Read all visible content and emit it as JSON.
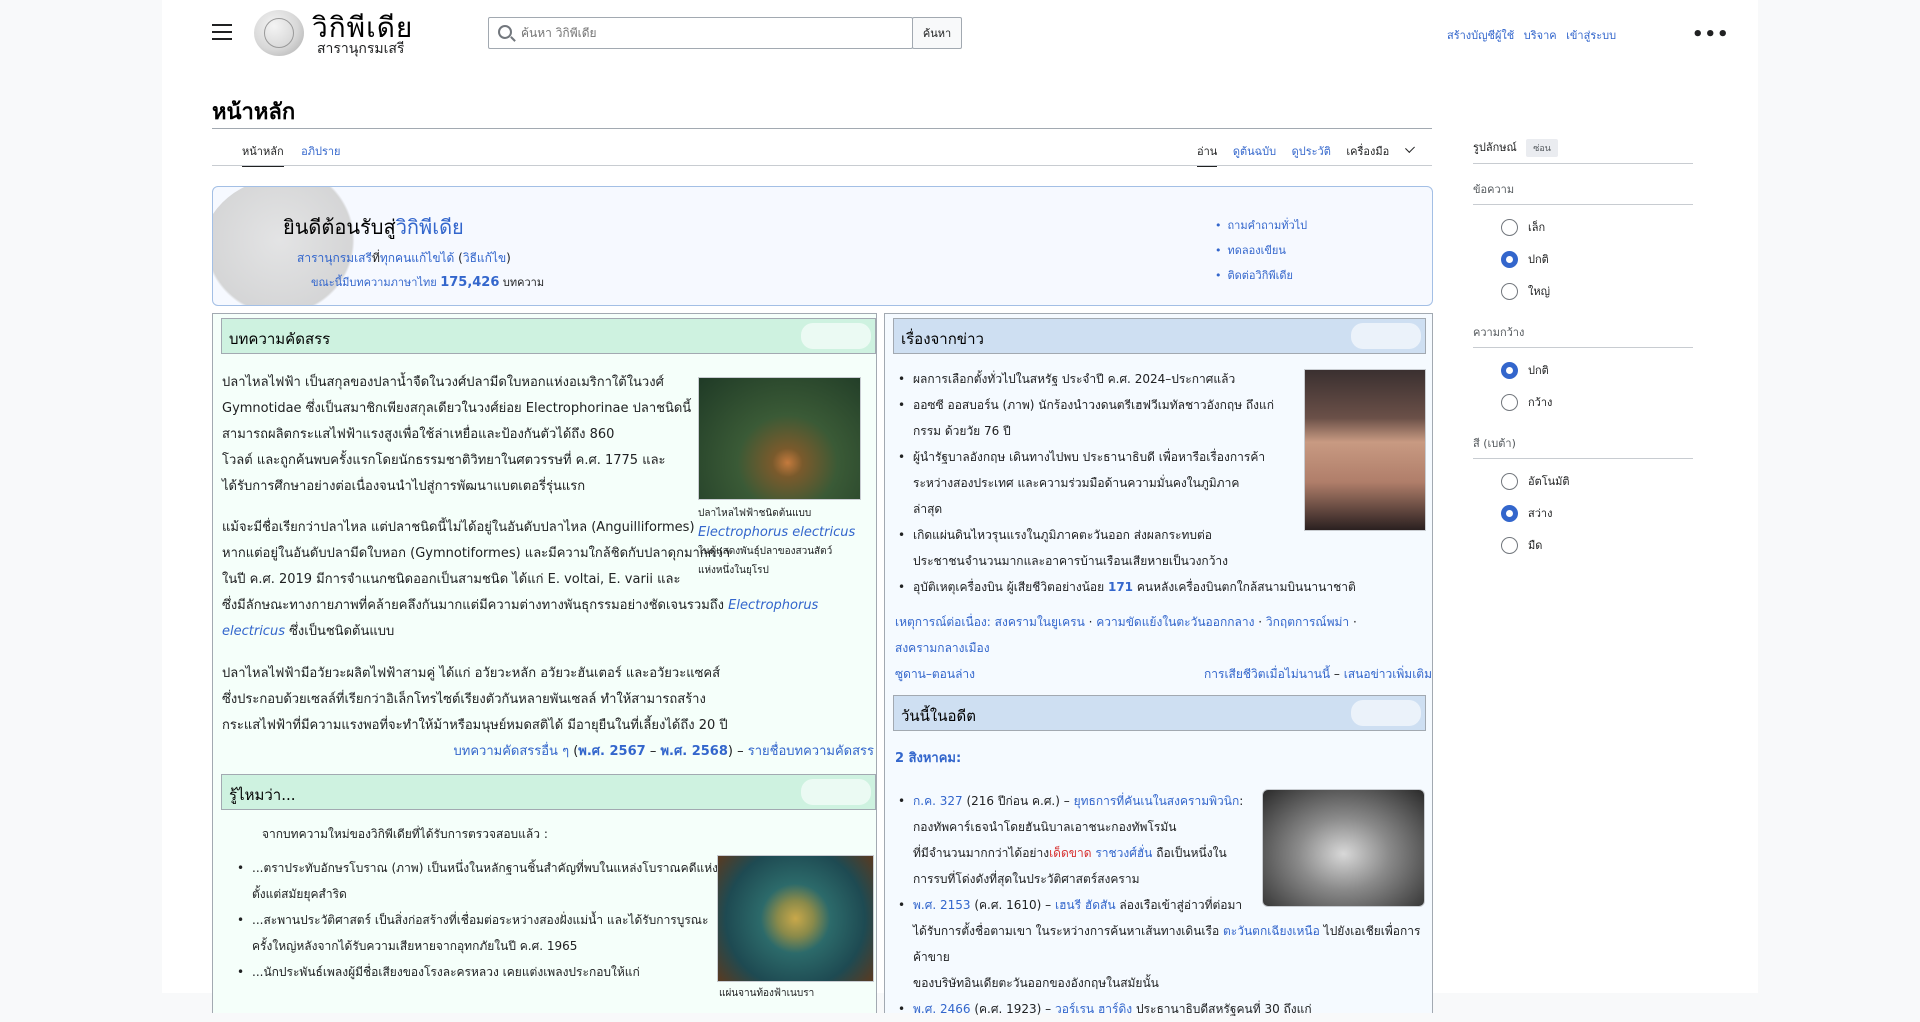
{
  "header": {
    "logo_title": "วิกิพีเดีย",
    "logo_subtitle": "สารานุกรมเสรี",
    "search_placeholder": "ค้นหา วิกิพีเดีย",
    "search_button": "ค้นหา",
    "top_links": [
      "สร้างบัญชีผู้ใช้",
      "บริจาค",
      "เข้าสู่ระบบ"
    ],
    "more": "•••"
  },
  "page": {
    "title": "หน้าหลัก",
    "tabs_left": [
      "หน้าหลัก",
      "อภิปราย"
    ],
    "tabs_right": [
      "อ่าน",
      "ดูต้นฉบับ",
      "ดูประวัติ",
      "เครื่องมือ"
    ]
  },
  "welcome": {
    "heading_plain": "ยินดีต้อนรับสู่",
    "heading_link": "วิกิพีเดีย",
    "sub_link1": "สารานุกรมเสรี",
    "sub_text": "ที่",
    "sub_link2": "ทุกคนแก้ไขได้",
    "sub_paren": "วิธีแก้ไข",
    "count_prefix_link": "ขณะนี้มีบทความภาษาไทย",
    "count_number": "175,426",
    "count_suffix": "บทความ",
    "links": [
      "ถามคำถามทั่วไป",
      "ทดลองเขียน",
      "ติดต่อวิกิพีเดีย"
    ]
  },
  "featured": {
    "heading": "บทความคัดสรร",
    "p1_l1": "ปลาไหลไฟฟ้า เป็นสกุลของปลาน้ำจืดในวงศ์ปลามีดใบหอกแห่งอเมริกาใต้ในวงศ์",
    "p1_l2": "Gymnotidae ซึ่งเป็นสมาชิกเพียงสกุลเดียวในวงศ์ย่อย Electrophorinae ปลาชนิดนี้",
    "p1_l3": "สามารถผลิตกระแสไฟฟ้าแรงสูงเพื่อใช้ล่าเหยื่อและป้องกันตัวได้ถึง 860",
    "p1_l4": "โวลต์ และถูกค้นพบครั้งแรกโดยนักธรรมชาติวิทยาในศตวรรษที่ ค.ศ. 1775 และ",
    "p1_l5": "ได้รับการศึกษาอย่างต่อเนื่องจนนำไปสู่การพัฒนาแบตเตอรี่รุ่นแรก",
    "p2_l1": "แม้จะมีชื่อเรียกว่าปลาไหล แต่ปลาชนิดนี้ไม่ได้อยู่ในอันดับปลาไหล (Anguilliformes)",
    "p2_l2": "หากแต่อยู่ในอันดับปลามีดใบหอก (Gymnotiformes) และมีความใกล้ชิดกับปลาดุกมากกว่า",
    "p2_l3": "ในปี ค.ศ. 2019 มีการจำแนกชนิดออกเป็นสามชนิด ได้แก่ E. voltai, E. varii และ",
    "p2_l4": "ซึ่งมีลักษณะทางกายภาพที่คล้ายคลึงกันมากแต่มีความต่างทางพันธุกรรมอย่างชัดเจนรวมถึง",
    "p2_l5_italic": "Electrophorus",
    "p2_l6_italic": "electricus",
    "p2_l6_rest": "ซึ่งเป็นชนิดต้นแบบ",
    "p3_l1": "ปลาไหลไฟฟ้ามีอวัยวะผลิตไฟฟ้าสามคู่ ได้แก่ อวัยวะหลัก อวัยวะฮันเตอร์ และอวัยวะแซคส์",
    "p3_l2": "ซึ่งประกอบด้วยเซลล์ที่เรียกว่าอิเล็กโทรไซต์เรียงตัวกันหลายพันเซลล์ ทำให้สามารถสร้าง",
    "p3_l3": "กระแสไฟฟ้าที่มีความแรงพอที่จะทำให้ม้าหรือมนุษย์หมดสติได้ มีอายุยืนในที่เลี้ยงได้ถึง 20 ปี",
    "footer_link1": "บทความคัดสรรอื่น ๆ",
    "footer_paren_open": "(",
    "footer_y1": "พ.ศ. 2567",
    "footer_mid": "–",
    "footer_y2": "พ.ศ. 2568",
    "footer_paren_close": ") –",
    "footer_link2": "รายชื่อบทความคัดสรร",
    "caption_l1": "ปลาไหลไฟฟ้าชนิดต้นแบบ",
    "caption_italic": "Electrophorus electricus",
    "caption_l3": "ในตู้แสดงพันธุ์ปลาของสวนสัตว์",
    "caption_l4": "แห่งหนึ่งในยุโรป"
  },
  "dyk": {
    "heading": "รู้ไหมว่า...",
    "intro": "จากบทความใหม่ของวิกิพีเดียที่ได้รับการตรวจสอบแล้ว :",
    "item1_l1": "...ตราประทับอักษรโบราณ (ภาพ) เป็นหนึ่งในหลักฐานชิ้นสำคัญที่พบในแหล่งโบราณคดีแห่งนี้",
    "item1_l2": "ตั้งแต่สมัยยุคสำริด",
    "item2_l1": "...สะพานประวัติศาสตร์ เป็นสิ่งก่อสร้างที่เชื่อมต่อระหว่างสองฝั่งแม่น้ำ และได้รับการบูรณะ",
    "item2_l2": "ครั้งใหญ่หลังจากได้รับความเสียหายจากอุทกภัยในปี ค.ศ. 1965",
    "item3_l1": "...นักประพันธ์เพลงผู้มีชื่อเสียงของโรงละครหลวง เคยแต่งเพลงประกอบให้แก่",
    "caption": "แผ่นจานท้องฟ้าเนบรา"
  },
  "news": {
    "heading": "เรื่องจากข่าว",
    "item1_l1": "ผลการเลือกตั้งทั่วไปในสหรัฐ ประจำปี ค.ศ. 2024–ประกาศแล้ว",
    "item2_l1": "ออซซี ออสบอร์น (ภาพ) นักร้องนำวงดนตรีเฮฟวีเมทัลชาวอังกฤษ ถึงแก่",
    "item2_l2": "กรรม ด้วยวัย 76 ปี",
    "item3_l1": "ผู้นำรัฐบาลอังกฤษ เดินทางไปพบ ประธานาธิบดี เพื่อหารือเรื่องการค้า",
    "item3_l2": "ระหว่างสองประเทศ และความร่วมมือด้านความมั่นคงในภูมิภาค",
    "item3_l3": "ล่าสุด",
    "item4_l1": "เกิดแผ่นดินไหวรุนแรงในภูมิภาคตะวันออก ส่งผลกระทบต่อ",
    "item4_l2": "ประชาชนจำนวนมากและอาคารบ้านเรือนเสียหายเป็นวงกว้าง",
    "item5_l1": "อุบัติเหตุเครื่องบิน ผู้เสียชีวิตอย่างน้อย",
    "item5_num": "171",
    "item5_rest": "คนหลังเครื่องบินตกใกล้สนามบินนานาชาติ",
    "ongoing_label": "เหตุการณ์ต่อเนื่อง:",
    "ongoing": [
      "สงครามในยูเครน",
      "ความขัดแย้งในตะวันออกกลาง",
      "วิกฤตการณ์พม่า",
      "สงครามกลางเมือง"
    ],
    "ongoing_tail": "ซูดาน–ตอนล่าง",
    "footer_link1": "การเสียชีวิตเมื่อไม่นานนี้",
    "footer_dash": "–",
    "footer_link2": "เสนอข่าวเพิ่มเติม"
  },
  "onthisday": {
    "heading": "วันนี้ในอดีต",
    "date": "2 สิงหาคม:",
    "item1_year": "ก.ค. 327",
    "item1_paren": "(216 ปีก่อน ค.ศ.) –",
    "item1_link": "ยุทธการที่คันเนในสงครามพิวนิก",
    "item1_l2": "กองทัพคาร์เธจนำโดยฮันนิบาลเอาชนะกองทัพโรมัน",
    "item1_l3": "ที่มีจำนวนมากกว่าได้อย่าง",
    "item1_red": "เด็ดขาด",
    "item1_l3b": "ราชวงศ์ฮั่น",
    "item1_l3c": "ถือเป็นหนึ่งใน",
    "item1_l4": "การรบที่โด่งดังที่สุดในประวัติศาสตร์สงคราม",
    "item2_year": "พ.ศ. 2153",
    "item2_paren": "(ค.ศ. 1610) –",
    "item2_link": "เฮนรี ฮัดสัน",
    "item2_l1b": "ล่องเรือเข้าสู่อ่าวที่ต่อมา",
    "item2_l2": "ได้รับการตั้งชื่อตามเขา ในระหว่างการค้นหาเส้นทางเดินเรือ",
    "item2_l2b": "ตะวันตกเฉียงเหนือ",
    "item2_l2c": "ไปยังเอเชียเพื่อการค้าขาย",
    "item2_l3": "ของบริษัทอินเดียตะวันออกของอังกฤษในสมัยนั้น",
    "item3_year": "พ.ศ. 2466",
    "item3_paren": "(ค.ศ. 1923) –",
    "item3_link": "วอร์เรน ฮาร์ดิง",
    "item3_l1b": "ประธานาธิบดีสหรัฐคนที่",
    "item3_l1c": "30 ถึงแก่"
  },
  "sidebar": {
    "appearance_label": "รูปลักษณ์",
    "hide_button": "ซ่อน",
    "text_title": "ข้อความ",
    "text_options": [
      "เล็ก",
      "ปกติ",
      "ใหญ่"
    ],
    "text_selected": 1,
    "width_title": "ความกว้าง",
    "width_options": [
      "ปกติ",
      "กว้าง"
    ],
    "width_selected": 0,
    "color_title": "สี (เบต้า)",
    "color_options": [
      "อัตโนมัติ",
      "สว่าง",
      "มืด"
    ],
    "color_selected": 1
  }
}
